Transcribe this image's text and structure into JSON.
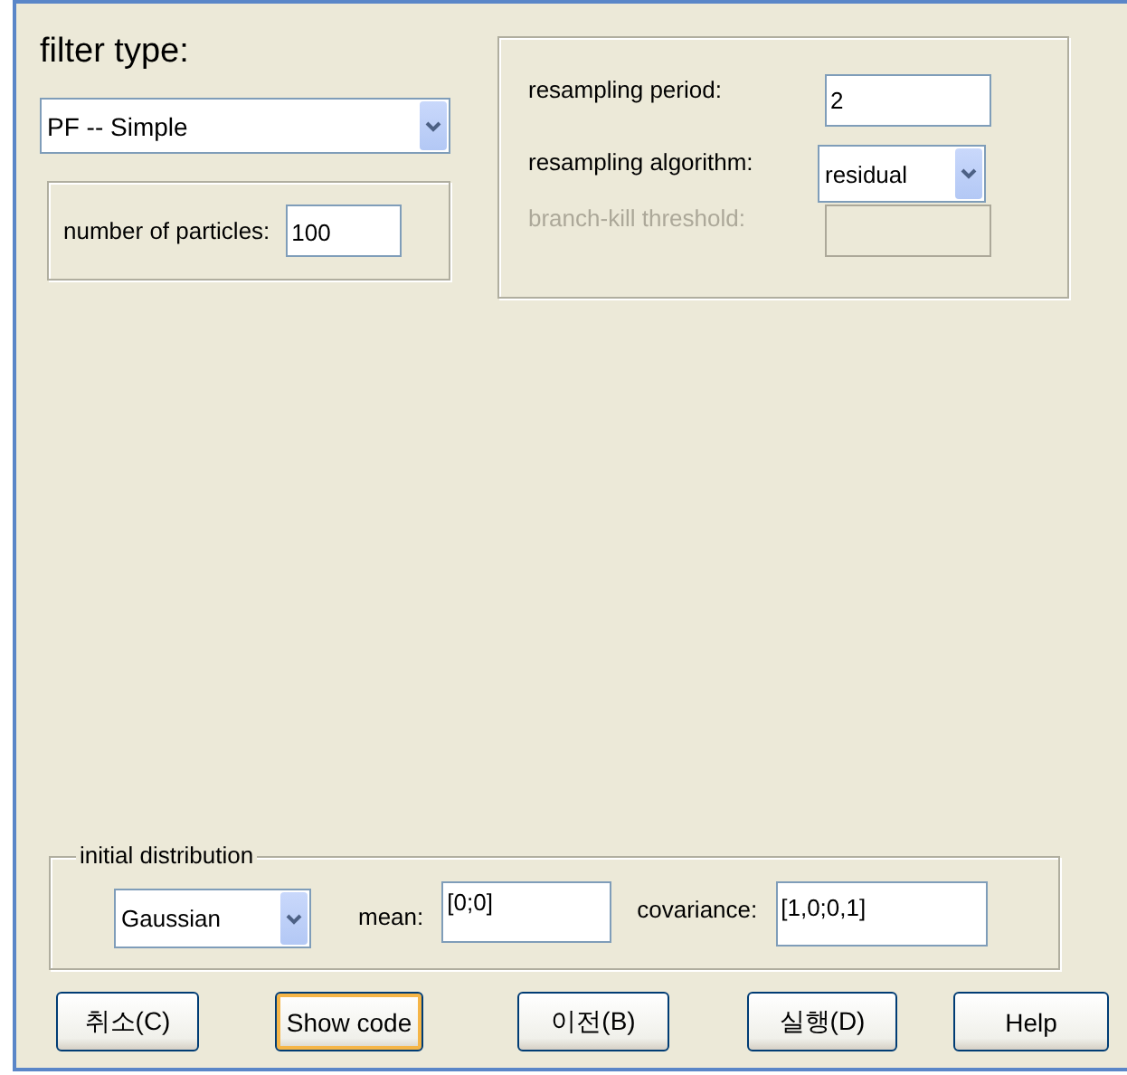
{
  "filter_type": {
    "label": "filter type:",
    "value": "PF -- Simple"
  },
  "particles": {
    "label": "number of particles:",
    "value": "100"
  },
  "resampling": [
    {
      "kind": "text",
      "label": "resampling period:",
      "value": "2",
      "disabled": false
    },
    {
      "kind": "dropdown",
      "label": "resampling algorithm:",
      "value": "residual",
      "disabled": false
    },
    {
      "kind": "text",
      "label": "branch-kill threshold:",
      "disabled": true
    }
  ],
  "initial_distribution": {
    "legend": "initial distribution",
    "type": "Gaussian",
    "mean_label": "mean:",
    "mean": "[0;0]",
    "covariance_label": "covariance:",
    "covariance": "[1,0;0,1]"
  },
  "buttons": [
    {
      "label": "취소(C)",
      "focused": false
    },
    {
      "label": "Show code",
      "focused": true
    },
    {
      "label": "이전(B)",
      "focused": false
    },
    {
      "label": "실행(D)",
      "focused": false
    },
    {
      "label": "Help",
      "focused": false
    }
  ]
}
